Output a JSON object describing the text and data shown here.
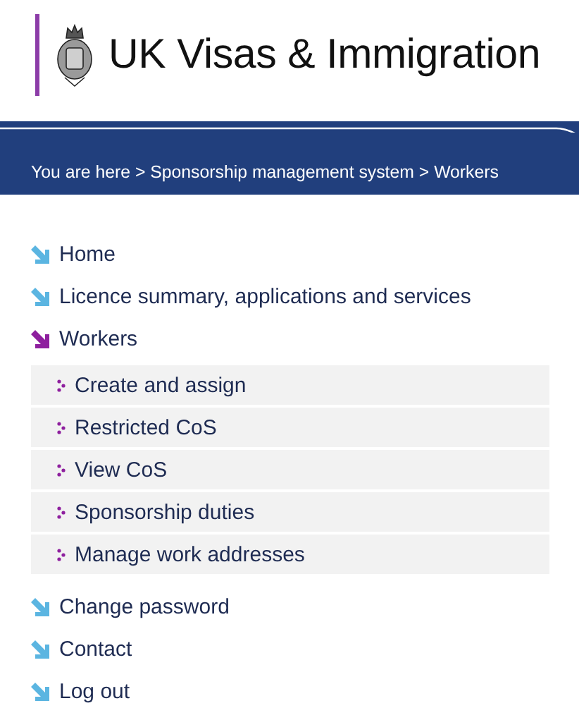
{
  "header": {
    "title": "UK Visas & Immigration"
  },
  "breadcrumb": {
    "text": "You are here > Sponsorship management system > Workers"
  },
  "nav": {
    "items": [
      {
        "label": "Home",
        "selected": false
      },
      {
        "label": "Licence summary, applications and services",
        "selected": false
      },
      {
        "label": "Workers",
        "selected": true,
        "children": [
          {
            "label": "Create and assign"
          },
          {
            "label": "Restricted CoS"
          },
          {
            "label": "View CoS"
          },
          {
            "label": "Sponsorship duties"
          },
          {
            "label": "Manage work addresses"
          }
        ]
      },
      {
        "label": "Change password",
        "selected": false
      },
      {
        "label": "Contact",
        "selected": false
      },
      {
        "label": "Log out",
        "selected": false
      }
    ]
  }
}
